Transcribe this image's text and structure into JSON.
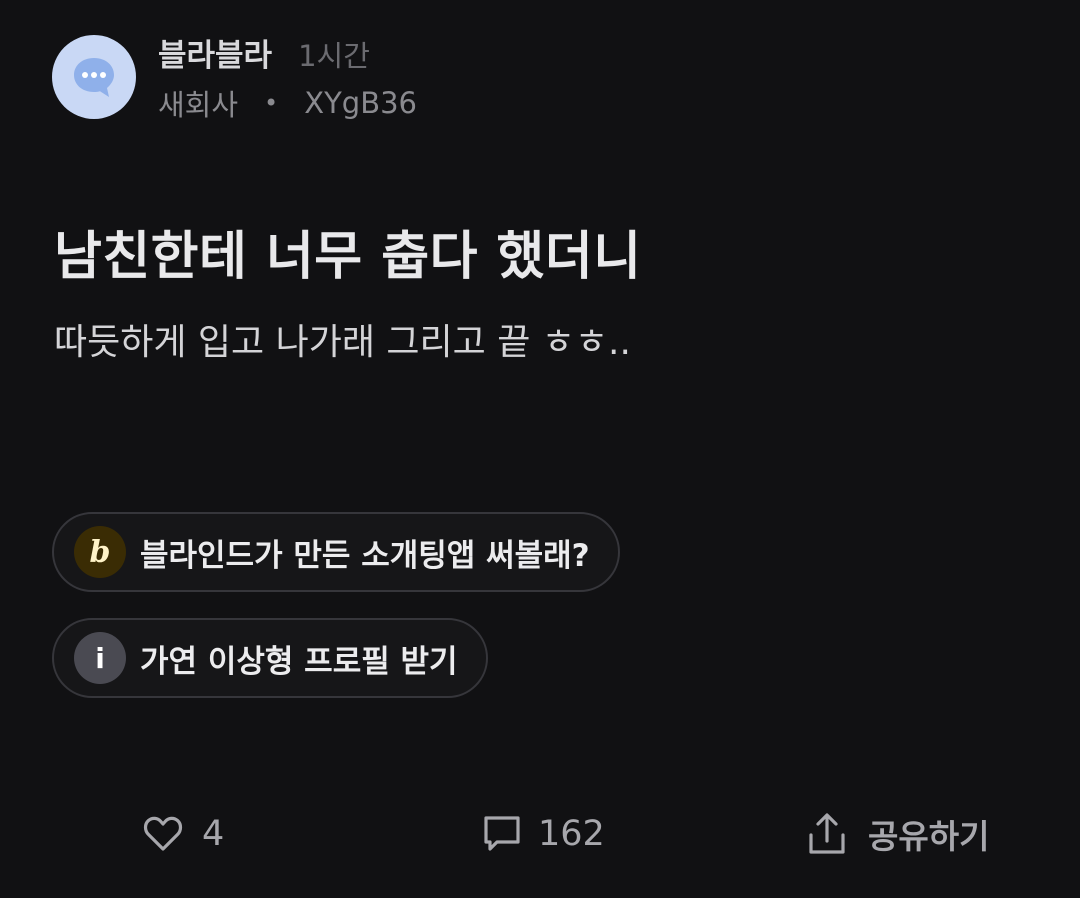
{
  "author": {
    "name": "블라블라",
    "time": "1시간",
    "company": "새회사",
    "separator": "•",
    "id": "XYgB36"
  },
  "post": {
    "title": "남친한테 너무 춥다 했더니",
    "body": "따듯하게 입고 나가래 그리고 끝 ㅎㅎ.."
  },
  "chips": [
    {
      "icon": "blind-logo-icon",
      "icon_text": "b",
      "label": "블라인드가 만든 소개팅앱 써볼래?"
    },
    {
      "icon": "info-icon",
      "icon_text": "i",
      "label": "가연 이상형 프로필 받기"
    }
  ],
  "actions": {
    "like": {
      "icon": "heart-icon",
      "count": "4"
    },
    "comment": {
      "icon": "comment-icon",
      "count": "162"
    },
    "share": {
      "icon": "share-icon",
      "label": "공유하기"
    }
  },
  "colors": {
    "background": "#111113",
    "avatar_bg": "#c9d8f5",
    "avatar_bubble": "#8fb0ea",
    "chip_border": "#36363b",
    "muted_text": "#8a8a8f"
  }
}
